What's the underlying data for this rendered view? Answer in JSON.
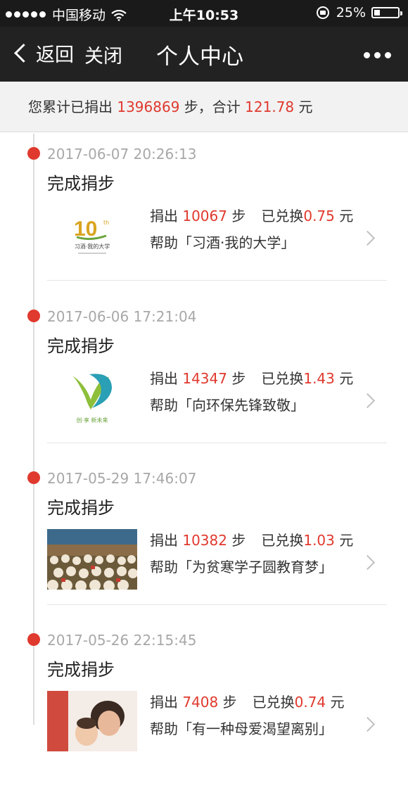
{
  "status_bar": {
    "carrier": "中国移动",
    "time": "上午10:53",
    "battery_percent": "25%",
    "battery_level": 0.25
  },
  "nav": {
    "back_label": "返回",
    "close_label": "关闭",
    "title": "个人中心"
  },
  "summary": {
    "prefix": "您累计已捐出",
    "steps": "1396869",
    "middle": "步，合计",
    "amount": "121.78",
    "suffix": "元"
  },
  "entries": [
    {
      "timestamp": "2017-06-07 20:26:13",
      "title": "完成捐步",
      "donate_prefix": "捐出",
      "steps": "10067",
      "steps_unit": "步",
      "exchanged_prefix": "已兑换",
      "amount": "0.75",
      "amount_unit": "元",
      "help_text": "帮助「习酒·我的大学」",
      "thumb_text": "习酒·我的大学"
    },
    {
      "timestamp": "2017-06-06 17:21:04",
      "title": "完成捐步",
      "donate_prefix": "捐出",
      "steps": "14347",
      "steps_unit": "步",
      "exchanged_prefix": "已兑换",
      "amount": "1.43",
      "amount_unit": "元",
      "help_text": "帮助「向环保先锋致敬」",
      "thumb_text": "创·享 新未来"
    },
    {
      "timestamp": "2017-05-29 17:46:07",
      "title": "完成捐步",
      "donate_prefix": "捐出",
      "steps": "10382",
      "steps_unit": "步",
      "exchanged_prefix": "已兑换",
      "amount": "1.03",
      "amount_unit": "元",
      "help_text": "帮助「为贫寒学子圆教育梦」"
    },
    {
      "timestamp": "2017-05-26 22:15:45",
      "title": "完成捐步",
      "donate_prefix": "捐出",
      "steps": "7408",
      "steps_unit": "步",
      "exchanged_prefix": "已兑换",
      "amount": "0.74",
      "amount_unit": "元",
      "help_text": "帮助「有一种母爱渴望离别」"
    }
  ],
  "colors": {
    "accent_red": "#e0392e",
    "nav_bg": "#222222",
    "summary_bg": "#f2f2f2"
  }
}
